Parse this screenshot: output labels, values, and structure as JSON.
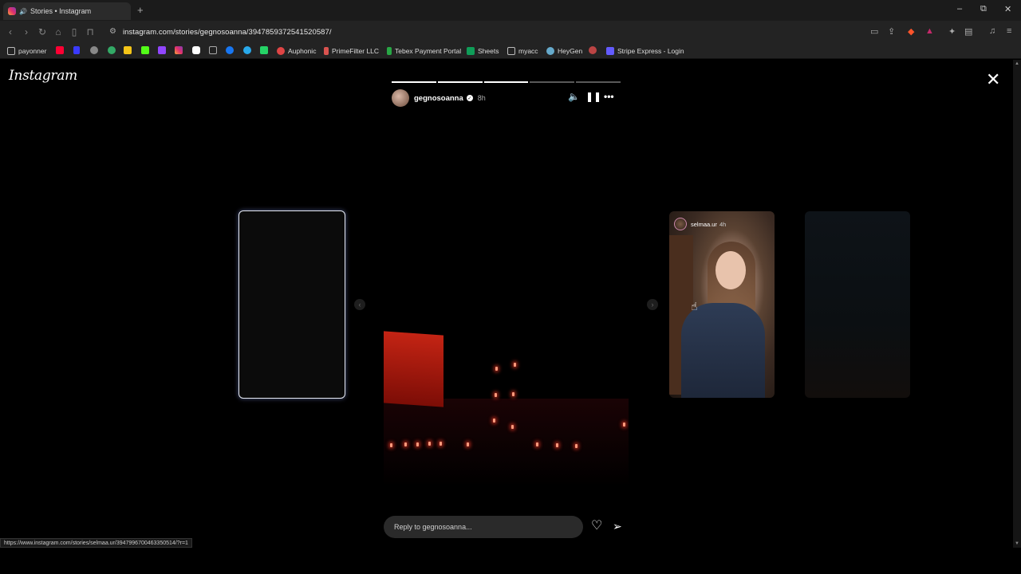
{
  "browser": {
    "tab_title": "Stories • Instagram",
    "new_tab": "+",
    "url": "instagram.com/stories/gegnosoanna/3947859372541520587/",
    "status_url": "https://www.instagram.com/stories/selmaa.ur/3947996700463350514/?r=1",
    "window_controls": [
      "–",
      "⧉",
      "✕"
    ]
  },
  "bookmarks": [
    {
      "label": "payonner",
      "icon": "folder-icon"
    },
    {
      "label": "Auphonic",
      "icon": "auphonic-icon"
    },
    {
      "label": "PrimeFilter LLC",
      "icon": "primefilter-icon"
    },
    {
      "label": "Tebex Payment Portal",
      "icon": "tebex-icon"
    },
    {
      "label": "Sheets",
      "icon": "sheets-icon"
    },
    {
      "label": "myacc",
      "icon": "folder-icon"
    },
    {
      "label": "HeyGen",
      "icon": "heygen-icon"
    },
    {
      "label": "Stripe Express - Login",
      "icon": "stripe-icon"
    }
  ],
  "page": {
    "logo": "Instagram",
    "close": "✕"
  },
  "story": {
    "username": "gegnosoanna",
    "time": "8h",
    "segments_total": 5,
    "segments_done": 3,
    "reply_placeholder": "Reply to gegnosoanna..."
  },
  "next_story": {
    "username": "selmaa.ur",
    "time": "4h"
  },
  "colors": {
    "background": "#000000",
    "reply_bg": "#2a2a2a",
    "flag_red": "#c42414"
  }
}
